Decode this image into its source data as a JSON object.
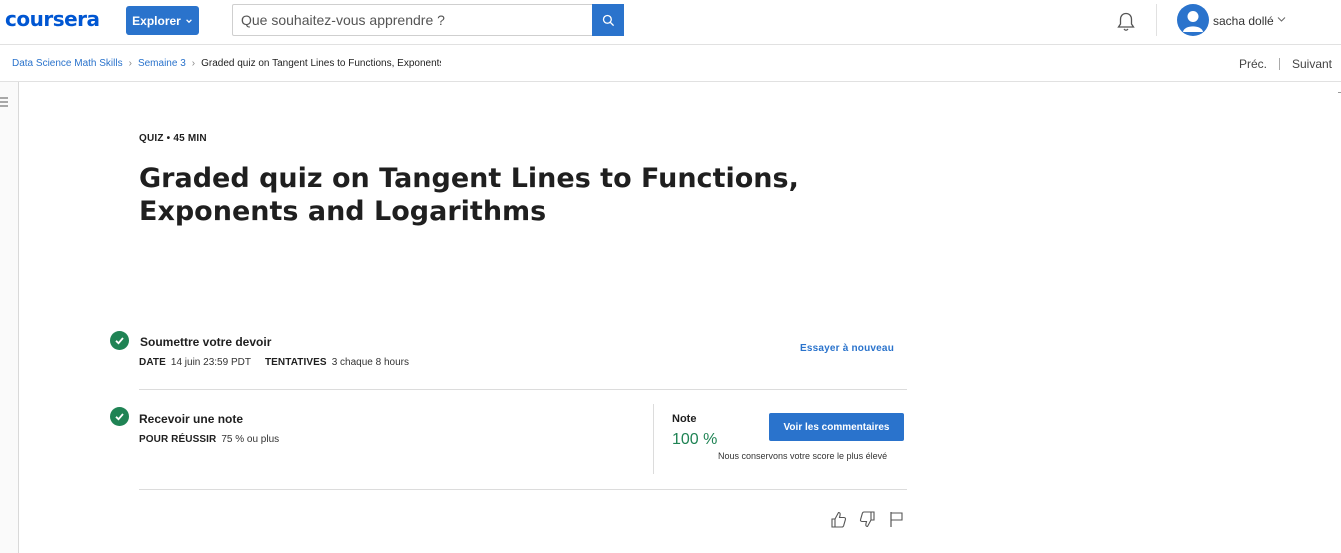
{
  "header": {
    "logo": "coursera",
    "explore_label": "Explorer",
    "search_placeholder": "Que souhaitez-vous apprendre ?",
    "user_name": "sacha dollé"
  },
  "breadcrumb": {
    "items": [
      "Data Science Math Skills",
      "Semaine 3",
      "Graded quiz on Tangent Lines to Functions, Exponents and Logarithms"
    ],
    "prev_label": "Préc.",
    "next_label": "Suivant"
  },
  "quiz": {
    "kicker": "QUIZ • 45  MIN",
    "title": "Graded quiz on Tangent Lines to Functions, Exponents and Logarithms"
  },
  "submit_section": {
    "title": "Soumettre votre devoir",
    "date_label": "DATE",
    "date_value": "14 juin 23:59 PDT",
    "attempts_label": "TENTATIVES",
    "attempts_value": "3 chaque 8  hours",
    "retry_label": "Essayer à nouveau"
  },
  "grade_section": {
    "title": "Recevoir une note",
    "pass_label": "POUR RÉUSSIR",
    "pass_value": "75 % ou plus",
    "grade_label": "Note",
    "grade_value": "100 %",
    "feedback_label": "Voir les commentaires",
    "keep_note": "Nous conservons votre score le plus élevé"
  },
  "colors": {
    "brand": "#0056d2",
    "accent": "#2a73cc",
    "success": "#1f8354"
  }
}
